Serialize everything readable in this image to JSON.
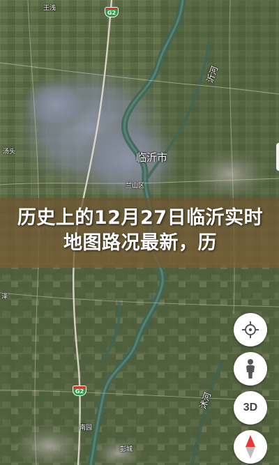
{
  "map": {
    "labels": {
      "city_main": "临沂市",
      "district": "兰山区",
      "river_right": "沂河",
      "river_bottom": "沭河",
      "left_town_1": "王浅",
      "left_town_2": "泽",
      "left_town_3": "汤头",
      "bottom_town_1": "南园",
      "bottom_town_2": "彭城"
    },
    "highway_shields": {
      "top": "G2",
      "bottom": "G2"
    }
  },
  "banner": {
    "text": "历史上的12月27日临沂实时地图路况最新，历"
  },
  "controls": {
    "locate_icon": "crosshair-icon",
    "street_view_icon": "pegman-icon",
    "three_d_label": "3D",
    "compass_icon": "compass-icon"
  },
  "colors": {
    "banner": "#6e5430",
    "compass_red": "#e53935",
    "highway_green": "#2f9a49"
  }
}
